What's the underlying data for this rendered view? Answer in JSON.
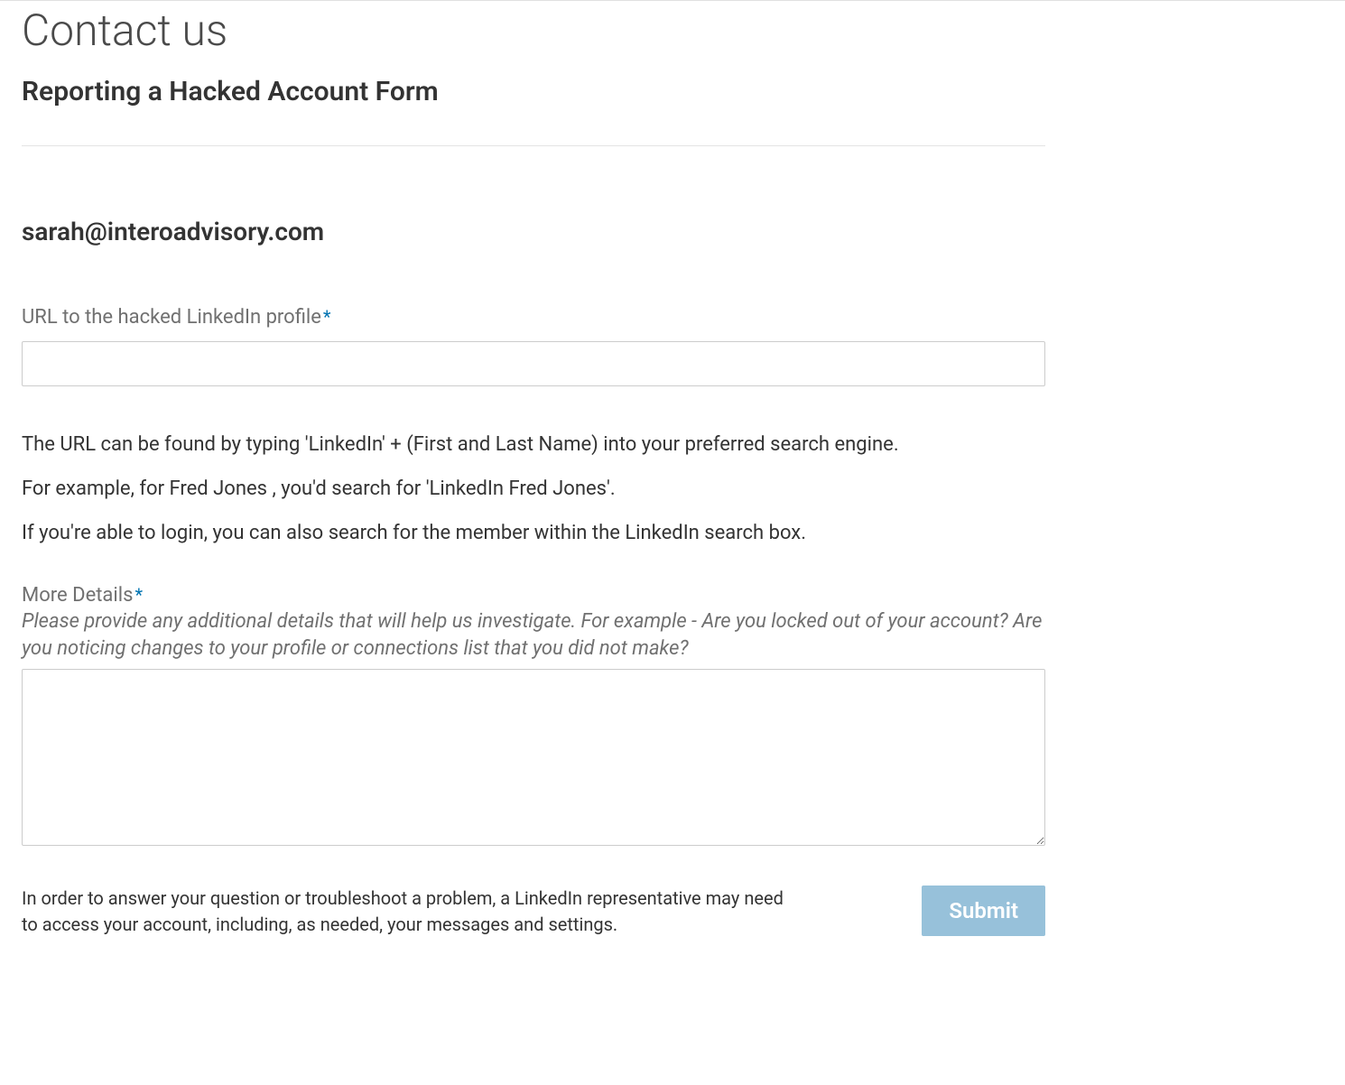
{
  "page": {
    "title": "Contact us",
    "form_title": "Reporting a Hacked Account Form"
  },
  "user": {
    "email": "sarah@interoadvisory.com"
  },
  "fields": {
    "url": {
      "label": "URL to the hacked LinkedIn profile",
      "required_mark": "*",
      "value": "",
      "help": {
        "line1": "The URL can be found by typing 'LinkedIn' + (First and Last Name) into your preferred search engine.",
        "line2": "For example, for Fred Jones , you'd search for 'LinkedIn Fred Jones'.",
        "line3": "If you're able to login, you can also search for the member within the LinkedIn search box."
      }
    },
    "details": {
      "label": "More Details",
      "required_mark": "*",
      "subtext": "Please provide any additional details that will help us investigate. For example - Are you locked out of your account? Are you noticing changes to your profile or connections list that you did not make?",
      "value": ""
    }
  },
  "footer": {
    "disclaimer": "In order to answer your question or troubleshoot a problem, a LinkedIn representative may need to access your account, including, as needed, your messages and settings.",
    "submit_label": "Submit"
  }
}
